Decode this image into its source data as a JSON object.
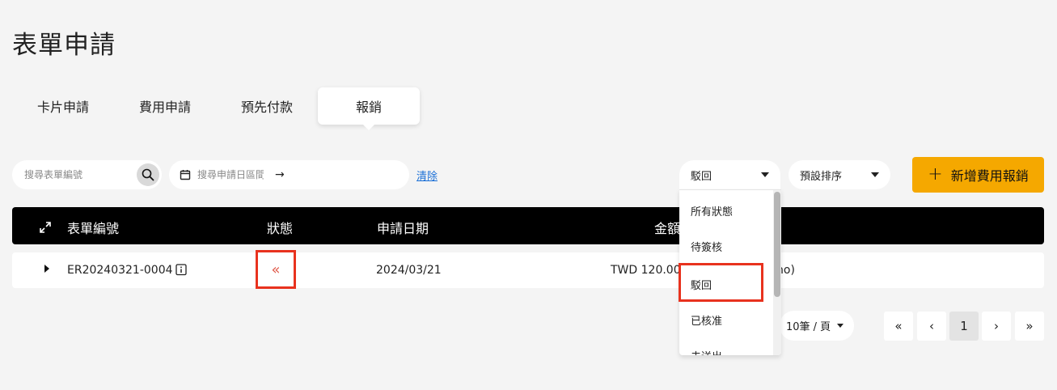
{
  "page_title": "表單申請",
  "tabs": [
    {
      "label": "卡片申請"
    },
    {
      "label": "費用申請"
    },
    {
      "label": "預先付款"
    },
    {
      "label": "報銷"
    }
  ],
  "filters": {
    "search_placeholder": "搜尋表單編號",
    "date_placeholder": "搜尋申請日區間",
    "clear_label": "清除",
    "status_selected": "駁回",
    "sort_selected": "預設排序",
    "add_button_label": "新增費用報銷"
  },
  "table": {
    "columns": [
      "表單編號",
      "狀態",
      "申請日期",
      "金額"
    ],
    "rows": [
      {
        "form_no": "ER20240321-0004",
        "date": "2024/03/21",
        "amount": "TWD 120.00",
        "tail": "no)"
      }
    ]
  },
  "status_options": [
    "所有狀態",
    "待簽核",
    "駁回",
    "已核准",
    "未送出"
  ],
  "pagination": {
    "page_size": "10筆 / 頁",
    "first": "«",
    "prev": "‹",
    "current": "1",
    "next": "›",
    "last": "»"
  },
  "colors": {
    "accent": "#f5a800",
    "highlight": "#e8321e",
    "header_bg": "#000000"
  },
  "icons": [
    "search-icon",
    "calendar-icon",
    "arrow-right-icon",
    "expand-icon",
    "caret-right-icon",
    "info-icon",
    "double-left-chevron-icon",
    "caret-down-icon",
    "plus-icon"
  ]
}
